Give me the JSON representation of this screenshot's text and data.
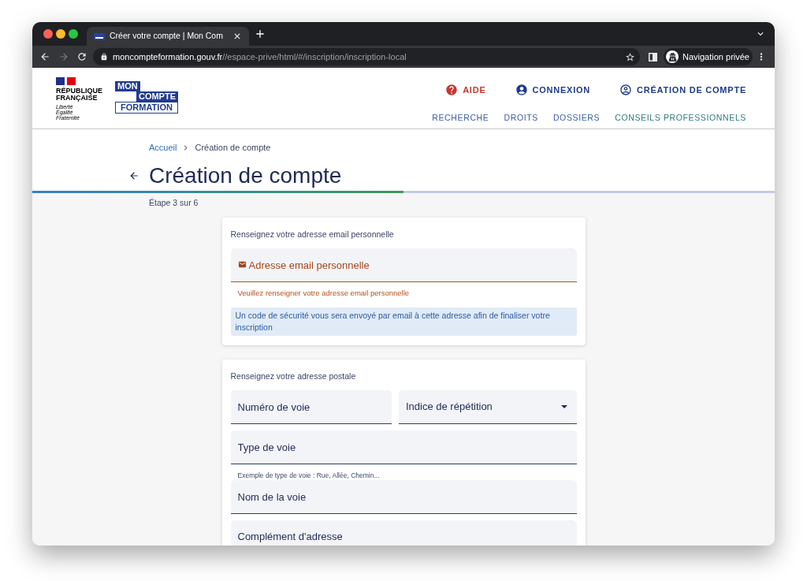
{
  "browser": {
    "tabs": [
      {
        "title": "Créer votre compte | Mon Com",
        "selected": true
      }
    ],
    "forward_disabled": true,
    "url": {
      "domain": "moncompteformation.gouv.fr",
      "path": "//espace-prive/html/#/inscription/inscription-local"
    },
    "profile": {
      "label": "Navigation privée"
    }
  },
  "header": {
    "republique": {
      "name": "RÉPUBLIQUE FRANÇAISE",
      "motto": "Liberté Égalité Fraternité"
    },
    "logo_words": [
      "MON",
      "COMPTE",
      "FORMATION"
    ],
    "nav_primary": [
      {
        "label": "AIDE",
        "kind": "help"
      },
      {
        "label": "CONNEXION",
        "kind": "login"
      },
      {
        "label": "CRÉATION DE COMPTE",
        "kind": "signup"
      }
    ],
    "nav_secondary": [
      {
        "label": "RECHERCHE",
        "color": "#3d5ea8"
      },
      {
        "label": "DROITS",
        "color": "#3d5ea8"
      },
      {
        "label": "DOSSIERS",
        "color": "#3d5ea8"
      },
      {
        "label": "CONSEILS PROFESSIONNELS",
        "color": "#2e7b7a"
      }
    ]
  },
  "breadcrumb": [
    {
      "label": "Accueil",
      "kind": "link"
    },
    {
      "label": "Création de compte",
      "kind": "current"
    }
  ],
  "page_title": "Création de compte",
  "progress": {
    "level": 0.5,
    "label": "Étape 3 sur 6"
  },
  "sections": [
    {
      "heading": "Renseignez votre adresse email personnelle",
      "rows": [
        [
          {
            "kind": "email",
            "placeholder": "Adresse email personnelle",
            "invalid": true,
            "error": "Veuillez renseigner votre adresse email personnelle"
          }
        ]
      ],
      "info": "Un code de sécurité vous sera envoyé par email à cette adresse afin de finaliser votre inscription"
    },
    {
      "heading": "Renseignez votre adresse postale",
      "rows": [
        [
          {
            "kind": "text",
            "placeholder": "Numéro de voie",
            "invalid": false
          },
          {
            "kind": "select",
            "placeholder": "Indice de répétition",
            "invalid": false
          }
        ],
        [
          {
            "kind": "text",
            "placeholder": "Type de voie",
            "invalid": false,
            "hint": "Exemple de type de voie : Rue, Allée, Chemin..."
          }
        ],
        [
          {
            "kind": "text",
            "placeholder": "Nom de la voie",
            "invalid": false
          }
        ],
        [
          {
            "kind": "text",
            "placeholder": "Complément d'adresse",
            "invalid": false
          }
        ]
      ]
    }
  ]
}
